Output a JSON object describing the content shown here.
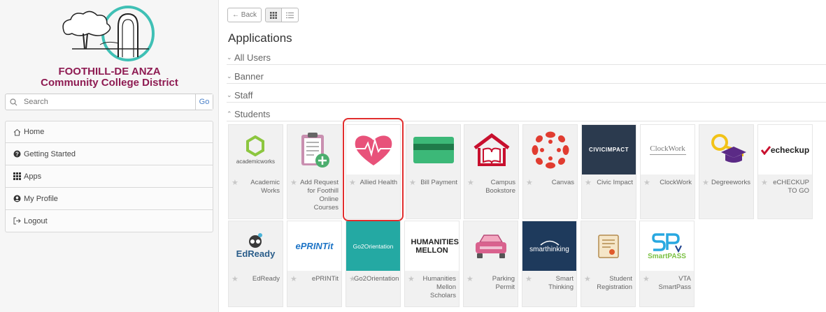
{
  "sidebar": {
    "logo_line1": "FOOTHILL-DE ANZA",
    "logo_line2": "Community College District",
    "search": {
      "placeholder": "Search",
      "go_label": "Go"
    },
    "nav": [
      {
        "label": "Home",
        "icon": "home-icon"
      },
      {
        "label": "Getting Started",
        "icon": "question-circle-icon"
      },
      {
        "label": "Apps",
        "icon": "grid-icon"
      },
      {
        "label": "My Profile",
        "icon": "user-circle-icon"
      },
      {
        "label": "Logout",
        "icon": "logout-icon"
      }
    ]
  },
  "toolbar": {
    "back_label": "← Back"
  },
  "page_title": "Applications",
  "sections": [
    {
      "label": "All Users",
      "expanded": false
    },
    {
      "label": "Banner",
      "expanded": false
    },
    {
      "label": "Staff",
      "expanded": false
    },
    {
      "label": "Students",
      "expanded": true
    }
  ],
  "tiles_row1": [
    {
      "label": "Academic Works",
      "logo_text": "academicworks"
    },
    {
      "label": "Add Request for Foothill Online Courses",
      "logo_text": ""
    },
    {
      "label": "Allied Health",
      "logo_text": ""
    },
    {
      "label": "Bill Payment",
      "logo_text": ""
    },
    {
      "label": "Campus Bookstore",
      "logo_text": ""
    },
    {
      "label": "Canvas",
      "logo_text": ""
    },
    {
      "label": "Civic Impact",
      "logo_text": "CIVICIMPACT"
    },
    {
      "label": "ClockWork",
      "logo_text": "ClockWork"
    },
    {
      "label": "Degreeworks",
      "logo_text": ""
    },
    {
      "label": "eCHECKUP TO GO",
      "logo_text": "echeckup"
    }
  ],
  "tiles_row2": [
    {
      "label": "EdReady",
      "logo_text": "EdReady"
    },
    {
      "label": "ePRINTit",
      "logo_text": "ePRINTit"
    },
    {
      "label": "Go2Orientation",
      "logo_text": "Go2Orientation"
    },
    {
      "label": "Humanities Mellon Scholars",
      "logo_text": "HUMANITIES MELLON"
    },
    {
      "label": "Parking Permit",
      "logo_text": ""
    },
    {
      "label": "Smart Thinking",
      "logo_text": "smarthinking"
    },
    {
      "label": "Student Registration",
      "logo_text": ""
    },
    {
      "label": "VTA SmartPass",
      "logo_text": "SmartPASS"
    }
  ],
  "colors": {
    "brand": "#8e1b52",
    "highlight": "#e12d2d",
    "link": "#4a80c8"
  }
}
